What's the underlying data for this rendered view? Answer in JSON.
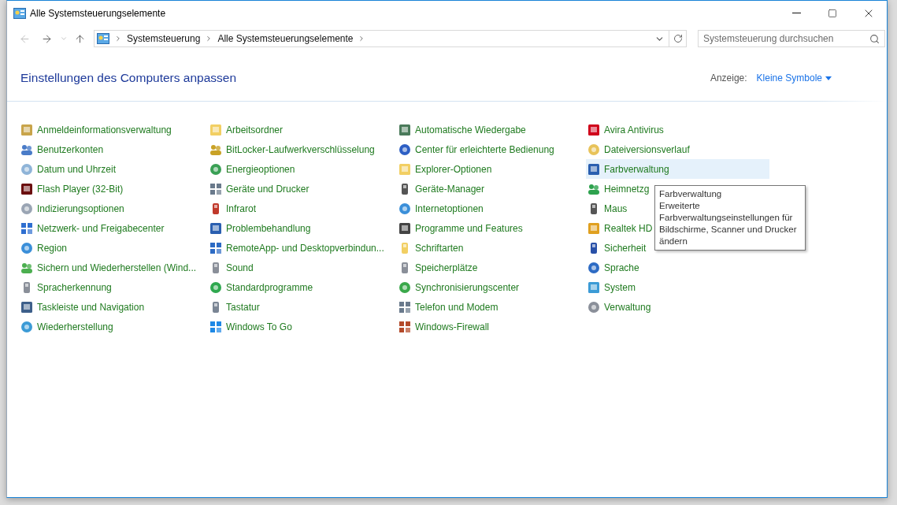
{
  "window": {
    "title": "Alle Systemsteuerungselemente"
  },
  "address_bar": {
    "breadcrumbs": [
      "Systemsteuerung",
      "Alle Systemsteuerungselemente"
    ]
  },
  "search": {
    "placeholder": "Systemsteuerung durchsuchen"
  },
  "header": {
    "title": "Einstellungen des Computers anpassen",
    "view_label": "Anzeige:",
    "view_value": "Kleine Symbole"
  },
  "columns": [
    [
      {
        "label": "Anmeldeinformationsverwaltung",
        "hovered": false
      },
      {
        "label": "Benutzerkonten",
        "hovered": false
      },
      {
        "label": "Datum und Uhrzeit",
        "hovered": false
      },
      {
        "label": "Flash Player (32-Bit)",
        "hovered": false
      },
      {
        "label": "Indizierungsoptionen",
        "hovered": false
      },
      {
        "label": "Netzwerk- und Freigabecenter",
        "hovered": false
      },
      {
        "label": "Region",
        "hovered": false
      },
      {
        "label": "Sichern und Wiederherstellen (Wind...",
        "hovered": false
      },
      {
        "label": "Spracherkennung",
        "hovered": false
      },
      {
        "label": "Taskleiste und Navigation",
        "hovered": false
      },
      {
        "label": "Wiederherstellung",
        "hovered": false
      }
    ],
    [
      {
        "label": "Arbeitsordner",
        "hovered": false
      },
      {
        "label": "BitLocker-Laufwerkverschlüsselung",
        "hovered": false
      },
      {
        "label": "Energieoptionen",
        "hovered": false
      },
      {
        "label": "Geräte und Drucker",
        "hovered": false
      },
      {
        "label": "Infrarot",
        "hovered": false
      },
      {
        "label": "Problembehandlung",
        "hovered": false
      },
      {
        "label": "RemoteApp- und Desktopverbindun...",
        "hovered": false
      },
      {
        "label": "Sound",
        "hovered": false
      },
      {
        "label": "Standardprogramme",
        "hovered": false
      },
      {
        "label": "Tastatur",
        "hovered": false
      },
      {
        "label": "Windows To Go",
        "hovered": false
      }
    ],
    [
      {
        "label": "Automatische Wiedergabe",
        "hovered": false
      },
      {
        "label": "Center für erleichterte Bedienung",
        "hovered": false
      },
      {
        "label": "Explorer-Optionen",
        "hovered": false
      },
      {
        "label": "Geräte-Manager",
        "hovered": false
      },
      {
        "label": "Internetoptionen",
        "hovered": false
      },
      {
        "label": "Programme und Features",
        "hovered": false
      },
      {
        "label": "Schriftarten",
        "hovered": false
      },
      {
        "label": "Speicherplätze",
        "hovered": false
      },
      {
        "label": "Synchronisierungscenter",
        "hovered": false
      },
      {
        "label": "Telefon und Modem",
        "hovered": false
      },
      {
        "label": "Windows-Firewall",
        "hovered": false
      }
    ],
    [
      {
        "label": "Avira Antivirus",
        "hovered": false
      },
      {
        "label": "Dateiversionsverlauf",
        "hovered": false
      },
      {
        "label": "Farbverwaltung",
        "hovered": true
      },
      {
        "label": "Heimnetzg",
        "hovered": false
      },
      {
        "label": "Maus",
        "hovered": false
      },
      {
        "label": "Realtek HD",
        "hovered": false
      },
      {
        "label": "Sicherheit",
        "hovered": false
      },
      {
        "label": "Sprache",
        "hovered": false
      },
      {
        "label": "System",
        "hovered": false
      },
      {
        "label": "Verwaltung",
        "hovered": false
      }
    ]
  ],
  "tooltip": {
    "title": "Farbverwaltung",
    "text": "Erweiterte Farbverwaltungseinstellungen für Bildschirme, Scanner und Drucker ändern"
  }
}
